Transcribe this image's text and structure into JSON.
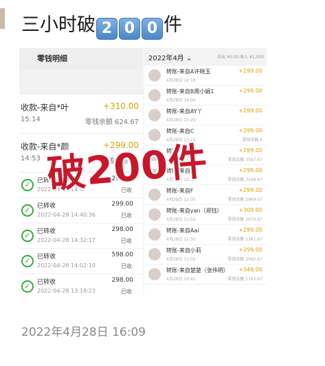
{
  "title": {
    "text": "三小时破",
    "digits": [
      "2",
      "0",
      "0"
    ],
    "suffix": "件"
  },
  "left_panel": {
    "header": "零钱明细",
    "transactions": [
      {
        "label": "收款-来自*叶",
        "amount": "+310.00",
        "time": "15:14",
        "balance": "零钱余额 624.67"
      },
      {
        "label": "收款-来自*颜",
        "amount": "+299.00",
        "time": "14:53",
        "balance": "零钱余额 31"
      }
    ],
    "records": [
      {
        "label": "已转收",
        "date": "2022-04-28 14:4",
        "value": "290.00",
        "status": "已收"
      },
      {
        "label": "已转收",
        "date": "2022-04-28 14:40:36",
        "value": "299.00",
        "status": "已收"
      },
      {
        "label": "已转收",
        "date": "2022-04-28 14:32:17",
        "value": "298.00",
        "status": "已收"
      },
      {
        "label": "已转收",
        "date": "2022-04-28 14:02:10",
        "value": "598.00",
        "status": "已收"
      },
      {
        "label": "已转收",
        "date": "2022-04-28 13:18:23",
        "value": "298.00",
        "status": "已收"
      }
    ]
  },
  "right_panel": {
    "month": "2022年4月",
    "summary": "支出 ¥0.00  收入 ¥1,000",
    "items": [
      {
        "name": "转账-来自A许晓玉",
        "date": "4月28日 14:18",
        "amount": "+299.00",
        "balance": ""
      },
      {
        "name": "转账-来自B周小娟1",
        "date": "4月28日 14:00",
        "amount": "+299.00",
        "balance": ""
      },
      {
        "name": "转账-来自AY丫",
        "date": "4月28日 13:29",
        "amount": "+299.00",
        "balance": ""
      },
      {
        "name": "转账-来自C",
        "date": "4月28日 13:10",
        "amount": "+299.00",
        "balance": "零钱余额 4"
      },
      {
        "name": "转账-来自D",
        "date": "4月28日 12:51",
        "amount": "+299.00",
        "balance": "零钱余额 3567.67"
      },
      {
        "name": "转账-来自E",
        "date": "4月28日 12:33",
        "amount": "+299.00",
        "balance": "零钱余额 3268.67"
      },
      {
        "name": "转账-来自F",
        "date": "4月28日 12:05",
        "amount": "+299.00",
        "balance": "零钱余额 2969.67"
      },
      {
        "name": "转账-来自yan（郑钰）",
        "date": "4月28日 11:52",
        "amount": "+309.00",
        "balance": "零钱余额 2670.67"
      },
      {
        "name": "转账-来自Aai",
        "date": "4月28日 11:30",
        "amount": "+299.00",
        "balance": "零钱余额 2361.67"
      },
      {
        "name": "转账-来自小莉",
        "date": "4月28日 11:02",
        "amount": "+299.00",
        "balance": "零钱余额 2062.67"
      },
      {
        "name": "转账-来自楚楚（张伟明）",
        "date": "4月28日 10:41",
        "amount": "+349.00",
        "balance": "零钱余额 1763.67"
      }
    ]
  },
  "overlay_text": "破200件",
  "timestamp": "2022年4月28日 16:09"
}
